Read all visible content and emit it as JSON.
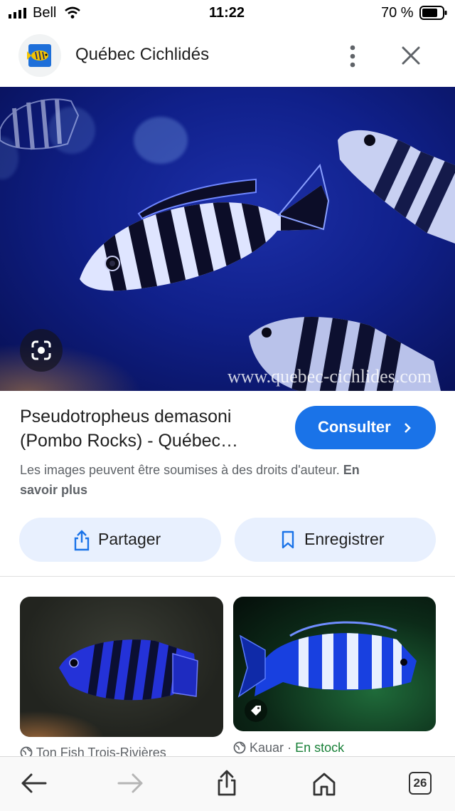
{
  "status_bar": {
    "carrier": "Bell",
    "time": "11:22",
    "battery": "70 %"
  },
  "header": {
    "site_name": "Québec Cichlidés",
    "icons": [
      "site-logo",
      "more-vert-icon",
      "close-icon"
    ]
  },
  "image": {
    "watermark": "www.quebec-cichlides.com",
    "icon": "lens-icon"
  },
  "result": {
    "title_line1": "Pseudotropheus demasoni",
    "title_line2": "(Pombo Rocks) - Québec…",
    "visit_label": "Consulter",
    "copyright_text": "Les images peuvent être soumises à des droits d'auteur.",
    "learn_more_line1": "En",
    "learn_more_line2": "savoir plus"
  },
  "actions": {
    "share_label": "Partager",
    "save_label": "Enregistrer"
  },
  "related": [
    {
      "source": "Ton Fish Trois-Rivières"
    },
    {
      "source": "Kauar",
      "separator": " · ",
      "stock": "En stock"
    }
  ],
  "bottom_nav": {
    "tabs_count": "26"
  },
  "colors": {
    "accent": "#1a73e8",
    "pill_bg": "#e8f0fe",
    "stock_green": "#188038"
  }
}
